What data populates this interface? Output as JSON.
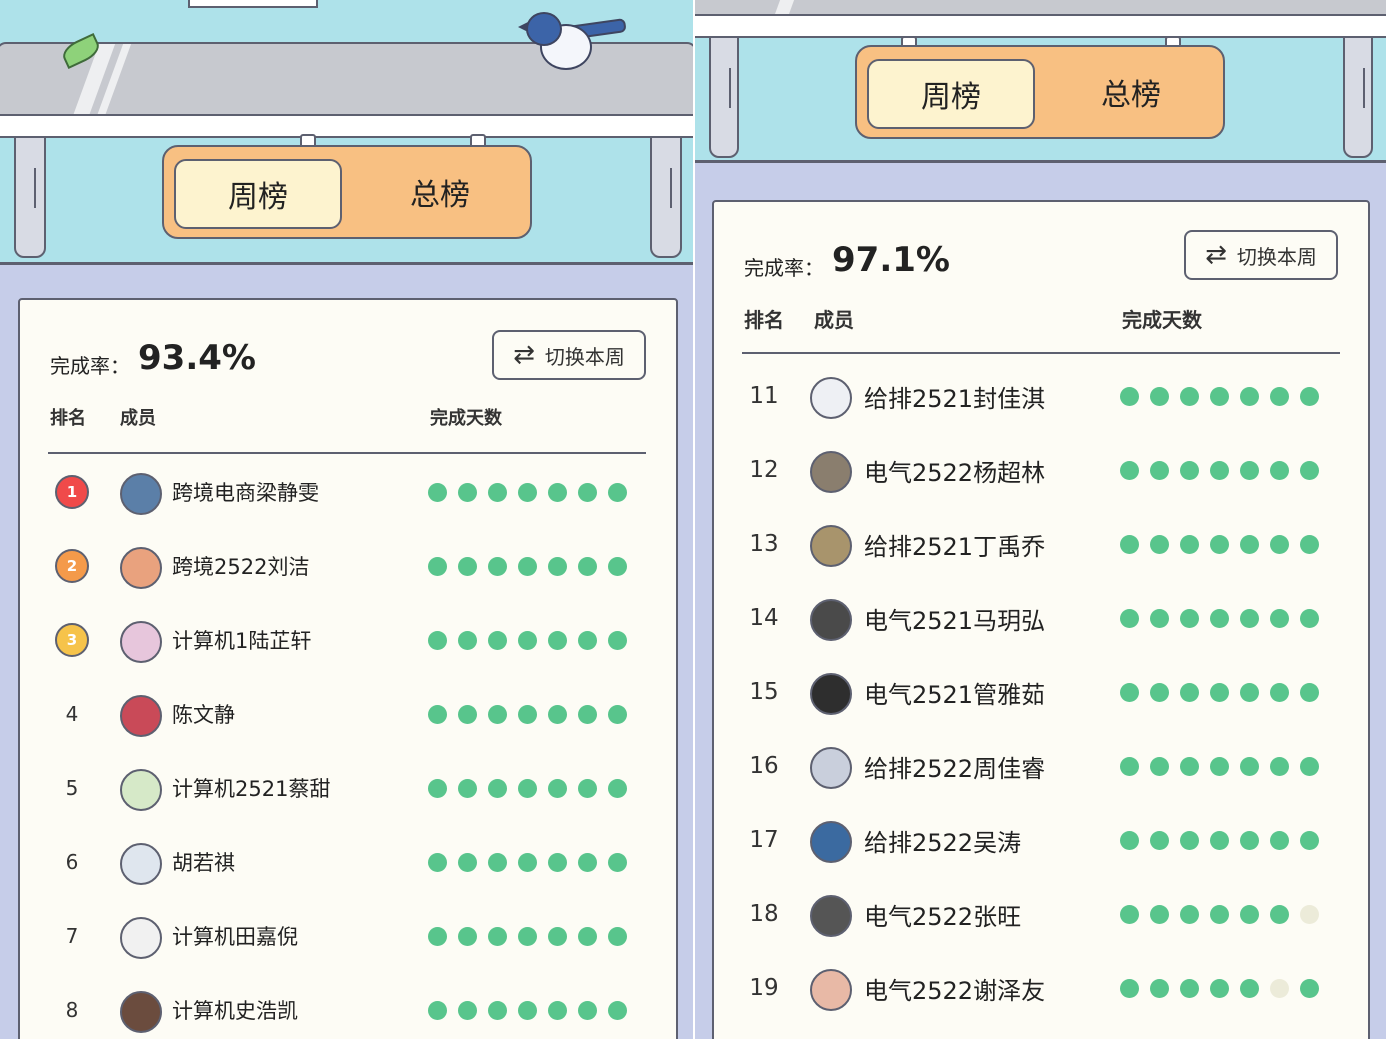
{
  "colors": {
    "done": "#58c58c",
    "missed": "#ecebd9",
    "tab_bg": "#f8c082",
    "tab_active": "#fdf3cf",
    "card": "#fdfcf5",
    "sky": "#aee2ea",
    "background": "#c6cde9"
  },
  "left": {
    "tabs": {
      "weekly": "周榜",
      "total": "总榜"
    },
    "rate_label": "完成率：",
    "rate_value": "93.4%",
    "switch_label": "切换本周",
    "headers": {
      "rank": "排名",
      "member": "成员",
      "days": "完成天数"
    },
    "rows": [
      {
        "rank": "1",
        "medal": "gold-medal-icon",
        "name": "跨境电商梁静雯",
        "days": [
          1,
          1,
          1,
          1,
          1,
          1,
          1
        ],
        "avatar_color": "#5b7fa8"
      },
      {
        "rank": "2",
        "medal": "silver-medal-icon",
        "name": "跨境2522刘洁",
        "days": [
          1,
          1,
          1,
          1,
          1,
          1,
          1
        ],
        "avatar_color": "#e9a27e"
      },
      {
        "rank": "3",
        "medal": "bronze-medal-icon",
        "name": "计算机1陆芷轩",
        "days": [
          1,
          1,
          1,
          1,
          1,
          1,
          1
        ],
        "avatar_color": "#e7c6dc"
      },
      {
        "rank": "4",
        "name": "陈文静",
        "days": [
          1,
          1,
          1,
          1,
          1,
          1,
          1
        ],
        "avatar_color": "#c94a58"
      },
      {
        "rank": "5",
        "name": "计算机2521蔡甜",
        "days": [
          1,
          1,
          1,
          1,
          1,
          1,
          1
        ],
        "avatar_color": "#d6e9c8"
      },
      {
        "rank": "6",
        "name": "胡若祺",
        "days": [
          1,
          1,
          1,
          1,
          1,
          1,
          1
        ],
        "avatar_color": "#dfe6ee"
      },
      {
        "rank": "7",
        "name": "计算机田嘉倪",
        "days": [
          1,
          1,
          1,
          1,
          1,
          1,
          1
        ],
        "avatar_color": "#f1f1f1"
      },
      {
        "rank": "8",
        "name": "计算机史浩凯",
        "days": [
          1,
          1,
          1,
          1,
          1,
          1,
          1
        ],
        "avatar_color": "#6b4c3e"
      }
    ]
  },
  "right": {
    "tabs": {
      "weekly": "周榜",
      "total": "总榜"
    },
    "rate_label": "完成率：",
    "rate_value": "97.1%",
    "switch_label": "切换本周",
    "headers": {
      "rank": "排名",
      "member": "成员",
      "days": "完成天数"
    },
    "rows": [
      {
        "rank": "11",
        "name": "给排2521封佳淇",
        "days": [
          1,
          1,
          1,
          1,
          1,
          1,
          1
        ],
        "avatar_color": "#eef0f4"
      },
      {
        "rank": "12",
        "name": "电气2522杨超林",
        "days": [
          1,
          1,
          1,
          1,
          1,
          1,
          1
        ],
        "avatar_color": "#8a7e6e"
      },
      {
        "rank": "13",
        "name": "给排2521丁禹乔",
        "days": [
          1,
          1,
          1,
          1,
          1,
          1,
          1
        ],
        "avatar_color": "#a8946c"
      },
      {
        "rank": "14",
        "name": "电气2521马玥弘",
        "days": [
          1,
          1,
          1,
          1,
          1,
          1,
          1
        ],
        "avatar_color": "#4a4a4a"
      },
      {
        "rank": "15",
        "name": "电气2521管雅茹",
        "days": [
          1,
          1,
          1,
          1,
          1,
          1,
          1
        ],
        "avatar_color": "#2e2e2e"
      },
      {
        "rank": "16",
        "name": "给排2522周佳睿",
        "days": [
          1,
          1,
          1,
          1,
          1,
          1,
          1
        ],
        "avatar_color": "#c9cfdc"
      },
      {
        "rank": "17",
        "name": "给排2522吴涛",
        "days": [
          1,
          1,
          1,
          1,
          1,
          1,
          1
        ],
        "avatar_color": "#3b6aa0"
      },
      {
        "rank": "18",
        "name": "电气2522张旺",
        "days": [
          1,
          1,
          1,
          1,
          1,
          1,
          0
        ],
        "avatar_color": "#555555"
      },
      {
        "rank": "19",
        "name": "电气2522谢泽友",
        "days": [
          1,
          1,
          1,
          1,
          1,
          0,
          1
        ],
        "avatar_color": "#e8b9a6"
      }
    ]
  }
}
